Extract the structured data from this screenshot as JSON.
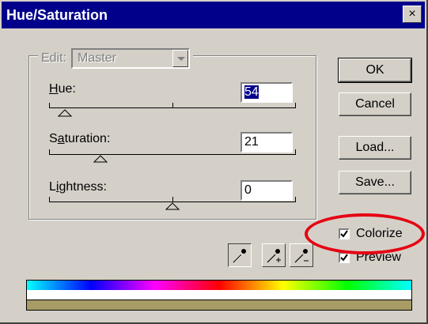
{
  "window": {
    "title": "Hue/Saturation",
    "close_symbol": "×"
  },
  "edit": {
    "label": "Edit:",
    "value": "Master"
  },
  "sliders": [
    {
      "label": "Hue:",
      "mnemonic": "H",
      "rest": "ue:",
      "value": "54"
    },
    {
      "label": "Saturation:",
      "mnemonic_pre": "S",
      "mnemonic": "a",
      "rest": "turation:",
      "value": "21"
    },
    {
      "label": "Lightness:",
      "mnemonic_pre": "L",
      "mnemonic": "i",
      "rest": "ghtness:",
      "value": "0"
    }
  ],
  "buttons": {
    "ok": "OK",
    "cancel": "Cancel",
    "load": "Load...",
    "save": "Save..."
  },
  "checkboxes": {
    "colorize": {
      "label": "Colorize",
      "checked": true
    },
    "preview": {
      "label": "Preview",
      "checked": true
    }
  },
  "colors": {
    "titlebar": "#00008a",
    "dialog_bg": "#d4d0c8",
    "annotation": "#e60012",
    "result_bar": "#a89b66"
  },
  "icons": [
    "eyedropper-icon",
    "eyedropper-plus-icon",
    "eyedropper-minus-icon"
  ]
}
